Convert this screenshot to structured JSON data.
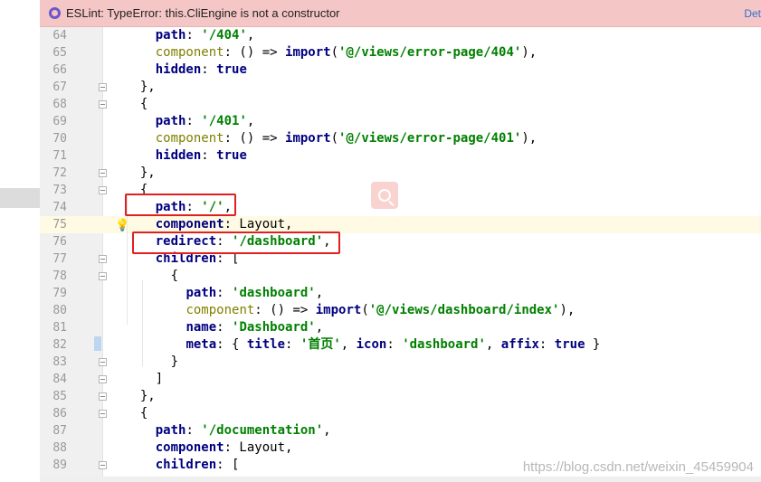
{
  "banner": {
    "message": "ESLint: TypeError: this.CliEngine is not a constructor",
    "action": "Det",
    "icon": "eslint-icon"
  },
  "lines": [
    {
      "n": "64",
      "tokens": [
        [
          "p",
          "    "
        ],
        [
          "k",
          "path"
        ],
        [
          "p",
          ": "
        ],
        [
          "s",
          "'/404'"
        ],
        [
          "p",
          ","
        ]
      ]
    },
    {
      "n": "65",
      "tokens": [
        [
          "p",
          "    "
        ],
        [
          "c",
          "component"
        ],
        [
          "p",
          ": () => "
        ],
        [
          "kw",
          "import"
        ],
        [
          "p",
          "("
        ],
        [
          "s",
          "'@/views/error-page/404'"
        ],
        [
          "p",
          "),"
        ]
      ]
    },
    {
      "n": "66",
      "tokens": [
        [
          "p",
          "    "
        ],
        [
          "k",
          "hidden"
        ],
        [
          "p",
          ": "
        ],
        [
          "kw",
          "true"
        ]
      ]
    },
    {
      "n": "67",
      "fold": true,
      "tokens": [
        [
          "p",
          "  },"
        ]
      ]
    },
    {
      "n": "68",
      "fold": true,
      "tokens": [
        [
          "p",
          "  {"
        ]
      ]
    },
    {
      "n": "69",
      "tokens": [
        [
          "p",
          "    "
        ],
        [
          "k",
          "path"
        ],
        [
          "p",
          ": "
        ],
        [
          "s",
          "'/401'"
        ],
        [
          "p",
          ","
        ]
      ]
    },
    {
      "n": "70",
      "tokens": [
        [
          "p",
          "    "
        ],
        [
          "c",
          "component"
        ],
        [
          "p",
          ": () => "
        ],
        [
          "kw",
          "import"
        ],
        [
          "p",
          "("
        ],
        [
          "s",
          "'@/views/error-page/401'"
        ],
        [
          "p",
          "),"
        ]
      ]
    },
    {
      "n": "71",
      "tokens": [
        [
          "p",
          "    "
        ],
        [
          "k",
          "hidden"
        ],
        [
          "p",
          ": "
        ],
        [
          "kw",
          "true"
        ]
      ]
    },
    {
      "n": "72",
      "fold": true,
      "tokens": [
        [
          "p",
          "  },"
        ]
      ]
    },
    {
      "n": "73",
      "fold": true,
      "tokens": [
        [
          "p",
          "  {"
        ]
      ]
    },
    {
      "n": "74",
      "tokens": [
        [
          "p",
          "    "
        ],
        [
          "k",
          "path"
        ],
        [
          "p",
          ": "
        ],
        [
          "s",
          "'/'"
        ],
        [
          "p",
          ","
        ]
      ]
    },
    {
      "n": "75",
      "current": true,
      "bulb": true,
      "tokens": [
        [
          "p",
          "    "
        ],
        [
          "k",
          "component"
        ],
        [
          "p",
          ": Layout,"
        ]
      ]
    },
    {
      "n": "76",
      "tokens": [
        [
          "p",
          "    "
        ],
        [
          "k",
          "redirect"
        ],
        [
          "p",
          ": "
        ],
        [
          "s",
          "'/dashboard'"
        ],
        [
          "p",
          ","
        ]
      ]
    },
    {
      "n": "77",
      "fold": true,
      "tokens": [
        [
          "p",
          "    "
        ],
        [
          "k",
          "children"
        ],
        [
          "p",
          ": ["
        ]
      ]
    },
    {
      "n": "78",
      "fold": true,
      "tokens": [
        [
          "p",
          "      {"
        ]
      ]
    },
    {
      "n": "79",
      "tokens": [
        [
          "p",
          "        "
        ],
        [
          "k",
          "path"
        ],
        [
          "p",
          ": "
        ],
        [
          "s",
          "'dashboard'"
        ],
        [
          "p",
          ","
        ]
      ]
    },
    {
      "n": "80",
      "tokens": [
        [
          "p",
          "        "
        ],
        [
          "c",
          "component"
        ],
        [
          "p",
          ": () => "
        ],
        [
          "kw",
          "import"
        ],
        [
          "p",
          "("
        ],
        [
          "s",
          "'@/views/dashboard/index'"
        ],
        [
          "p",
          "),"
        ]
      ]
    },
    {
      "n": "81",
      "tokens": [
        [
          "p",
          "        "
        ],
        [
          "k",
          "name"
        ],
        [
          "p",
          ": "
        ],
        [
          "s",
          "'Dashboard'"
        ],
        [
          "p",
          ","
        ]
      ]
    },
    {
      "n": "82",
      "bookmark": true,
      "tokens": [
        [
          "p",
          "        "
        ],
        [
          "k",
          "meta"
        ],
        [
          "p",
          ": { "
        ],
        [
          "k",
          "title"
        ],
        [
          "p",
          ": "
        ],
        [
          "s",
          "'首页'"
        ],
        [
          "p",
          ", "
        ],
        [
          "k",
          "icon"
        ],
        [
          "p",
          ": "
        ],
        [
          "s",
          "'dashboard'"
        ],
        [
          "p",
          ", "
        ],
        [
          "k",
          "affix"
        ],
        [
          "p",
          ": "
        ],
        [
          "kw",
          "true"
        ],
        [
          "p",
          " }"
        ]
      ]
    },
    {
      "n": "83",
      "fold": true,
      "tokens": [
        [
          "p",
          "      }"
        ]
      ]
    },
    {
      "n": "84",
      "fold": true,
      "tokens": [
        [
          "p",
          "    ]"
        ]
      ]
    },
    {
      "n": "85",
      "fold": true,
      "tokens": [
        [
          "p",
          "  },"
        ]
      ]
    },
    {
      "n": "86",
      "fold": true,
      "tokens": [
        [
          "p",
          "  {"
        ]
      ]
    },
    {
      "n": "87",
      "tokens": [
        [
          "p",
          "    "
        ],
        [
          "k",
          "path"
        ],
        [
          "p",
          ": "
        ],
        [
          "s",
          "'/documentation'"
        ],
        [
          "p",
          ","
        ]
      ]
    },
    {
      "n": "88",
      "tokens": [
        [
          "p",
          "    "
        ],
        [
          "k",
          "component"
        ],
        [
          "p",
          ": Layout,"
        ]
      ]
    },
    {
      "n": "89",
      "fold": true,
      "tokens": [
        [
          "p",
          "    "
        ],
        [
          "k",
          "children"
        ],
        [
          "p",
          ": ["
        ]
      ]
    }
  ],
  "watermark": "https://blog.csdn.net/weixin_45459904",
  "colors": {
    "highlight_box": "#e02020",
    "banner_bg": "#f5c6c6",
    "current_line": "#fffae3"
  }
}
